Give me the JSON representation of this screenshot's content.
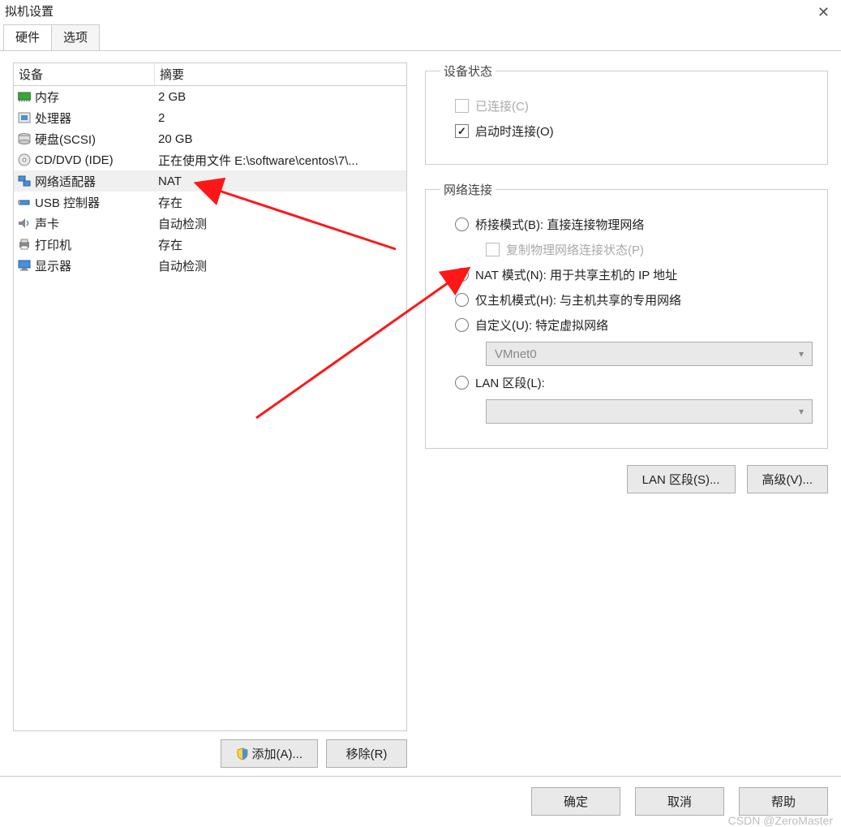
{
  "window": {
    "title": "拟机设置"
  },
  "tabs": {
    "hardware": "硬件",
    "options": "选项"
  },
  "deviceList": {
    "header_device": "设备",
    "header_summary": "摘要",
    "rows": [
      {
        "name": "内存",
        "summary": "2 GB",
        "icon": "memory"
      },
      {
        "name": "处理器",
        "summary": "2",
        "icon": "cpu"
      },
      {
        "name": "硬盘(SCSI)",
        "summary": "20 GB",
        "icon": "hdd"
      },
      {
        "name": "CD/DVD (IDE)",
        "summary": "正在使用文件 E:\\software\\centos\\7\\...",
        "icon": "cd"
      },
      {
        "name": "网络适配器",
        "summary": "NAT",
        "icon": "net"
      },
      {
        "name": "USB 控制器",
        "summary": "存在",
        "icon": "usb"
      },
      {
        "name": "声卡",
        "summary": "自动检测",
        "icon": "sound"
      },
      {
        "name": "打印机",
        "summary": "存在",
        "icon": "printer"
      },
      {
        "name": "显示器",
        "summary": "自动检测",
        "icon": "display"
      }
    ]
  },
  "leftButtons": {
    "add": "添加(A)...",
    "remove": "移除(R)"
  },
  "deviceStatus": {
    "legend": "设备状态",
    "connected": "已连接(C)",
    "connect_on_start": "启动时连接(O)"
  },
  "network": {
    "legend": "网络连接",
    "bridge": "桥接模式(B): 直接连接物理网络",
    "replicate": "复制物理网络连接状态(P)",
    "nat": "NAT 模式(N): 用于共享主机的 IP 地址",
    "hostonly": "仅主机模式(H): 与主机共享的专用网络",
    "custom": "自定义(U): 特定虚拟网络",
    "custom_net": "VMnet0",
    "lan": "LAN 区段(L):",
    "lan_value": ""
  },
  "rightButtons": {
    "lanseg": "LAN 区段(S)...",
    "advanced": "高级(V)..."
  },
  "footer": {
    "ok": "确定",
    "cancel": "取消",
    "help": "帮助"
  },
  "watermark": "CSDN @ZeroMaster"
}
